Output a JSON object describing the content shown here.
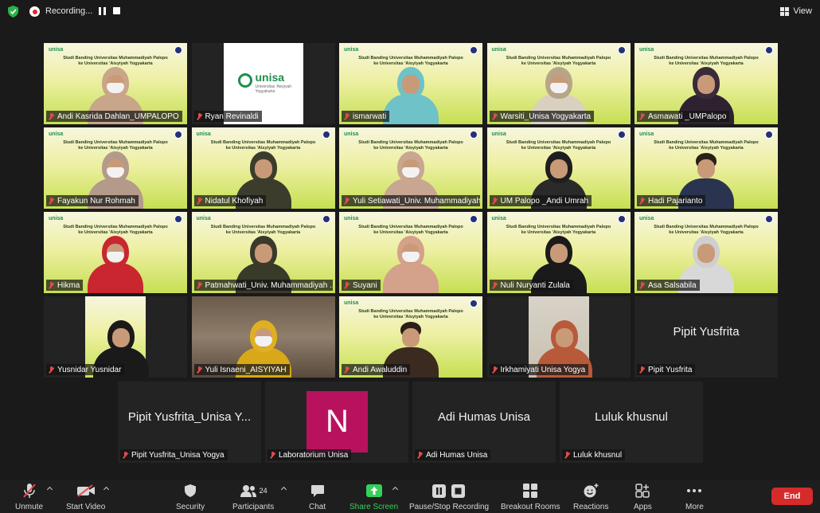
{
  "topbar": {
    "recording_label": "Recording...",
    "view_label": "View"
  },
  "tiles": [
    {
      "name": "Andi Kasrida Dahlan_UMPALOPO",
      "kind": "slide",
      "mask": true,
      "hijab": "#c9a58a",
      "clothes": "#c9a58a"
    },
    {
      "name": "Ryan Revinaldi",
      "kind": "logo"
    },
    {
      "name": "ismarwati",
      "kind": "slide",
      "mask": false,
      "hijab": "#6ec2c8",
      "clothes": "#6ec2c8"
    },
    {
      "name": "Warsiti_Unisa Yogyakarta",
      "kind": "slide",
      "mask": true,
      "hijab": "#b7a58a",
      "clothes": "#d9d0c0",
      "active": true
    },
    {
      "name": "Asmawati _UMPalopo",
      "kind": "slide",
      "mask": false,
      "hijab": "#3a2a3a",
      "clothes": "#2f2230"
    },
    {
      "name": "Fayakun Nur Rohmah",
      "kind": "slide",
      "mask": true,
      "hijab": "#b49a8a",
      "clothes": "#b49a8a"
    },
    {
      "name": "Nidatul Khofiyah",
      "kind": "slide",
      "mask": false,
      "hijab": "#3c3c2c",
      "clothes": "#3c3c2c"
    },
    {
      "name": "Yuli Setiawati_Univ. Muhammadiyah ...",
      "kind": "slide",
      "mask": true,
      "hijab": "#c8a692",
      "clothes": "#c8a692"
    },
    {
      "name": "UM Palopo _Andi Umrah",
      "kind": "slide",
      "mask": false,
      "hijab": "#1e1e1e",
      "clothes": "#2a2a2a"
    },
    {
      "name": "Hadi Pajarianto",
      "kind": "slide",
      "mask": false,
      "hijab": "#2a2018",
      "clothes": "#2a3450",
      "male": true
    },
    {
      "name": "Hikma",
      "kind": "slide",
      "mask": true,
      "hijab": "#c92630",
      "clothes": "#c92630"
    },
    {
      "name": "Patmahwati_Univ. Muhammadiyah ...",
      "kind": "slide",
      "mask": false,
      "hijab": "#3a3a2a",
      "clothes": "#3a3a2a"
    },
    {
      "name": "Suyani",
      "kind": "slide",
      "mask": true,
      "hijab": "#d4a18a",
      "clothes": "#d4a18a"
    },
    {
      "name": "Nuli Nuryanti Zulala",
      "kind": "slide",
      "mask": false,
      "hijab": "#1a1a1a",
      "clothes": "#1a1a1a"
    },
    {
      "name": "Asa Salsabila",
      "kind": "slide",
      "mask": false,
      "hijab": "#cfcfcf",
      "clothes": "#d8d8d8"
    },
    {
      "name": "Yusnidar Yusnidar",
      "kind": "portrait",
      "hijab": "#1a1a1a",
      "clothes": "#1a1a1a"
    },
    {
      "name": "Yuli Isnaeni_AISYIYAH",
      "kind": "room",
      "mask": true,
      "hijab": "#e0b020",
      "clothes": "#d8a818"
    },
    {
      "name": "Andi Awaluddin",
      "kind": "slide",
      "mask": false,
      "hijab": "#1e1e1e",
      "clothes": "#3a2a20",
      "male": true
    },
    {
      "name": "Irkhamiyati Unisa Yogya",
      "kind": "portrait-room",
      "hijab": "#b85a3a",
      "clothes": "#b85a3a"
    },
    {
      "name": "Pipit Yusfrita",
      "kind": "text",
      "display": "Pipit Yusfrita"
    }
  ],
  "tiles_row5": [
    {
      "name": "Pipit Yusfrita_Unisa Yogya",
      "kind": "text",
      "display": "Pipit Yusfrita_Unisa Y..."
    },
    {
      "name": "Laboratorium Unisa",
      "kind": "avatar",
      "display": "N"
    },
    {
      "name": "Adi Humas Unisa",
      "kind": "text",
      "display": "Adi Humas Unisa"
    },
    {
      "name": "Luluk khusnul",
      "kind": "text",
      "display": "Luluk khusnul"
    }
  ],
  "slide_text": {
    "brand": "unisa",
    "line1": "Studi Banding Universitas Muhammadiyah Palopo",
    "line2": "ke Universitas 'Aisyiyah Yogyakarta"
  },
  "logo_card": {
    "title": "unisa",
    "subtitle": "Universitas 'Aisyiyah Yogyakarta"
  },
  "toolbar": {
    "unmute": "Unmute",
    "start_video": "Start Video",
    "security": "Security",
    "participants": "Participants",
    "participants_count": "24",
    "chat": "Chat",
    "share_screen": "Share Screen",
    "pause_stop": "Pause/Stop Recording",
    "breakout": "Breakout Rooms",
    "reactions": "Reactions",
    "apps": "Apps",
    "more": "More",
    "end": "End"
  },
  "colors": {
    "active_border": "#2bd23a",
    "end_button": "#d52b2b",
    "share_green": "#35d05a",
    "avatar_magenta": "#b8125f",
    "muted_red": "#e24b4b"
  }
}
